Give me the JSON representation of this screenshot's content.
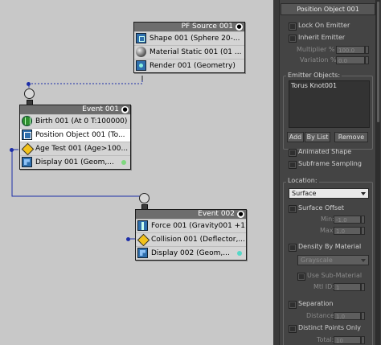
{
  "nodes": {
    "pf_source": {
      "title": "PF Source 001",
      "rows": [
        {
          "label": "Shape 001 (Sphere 20-...",
          "icon": "shape-icon"
        },
        {
          "label": "Material Static 001 (01 ...",
          "icon": "material-icon"
        },
        {
          "label": "Render 001 (Geometry)",
          "icon": "render-icon"
        }
      ]
    },
    "event1": {
      "title": "Event 001",
      "rows": [
        {
          "label": "Birth 001 (At 0 T:100000)",
          "icon": "birth-icon"
        },
        {
          "label": "Position Object 001 (To...",
          "icon": "position-icon"
        },
        {
          "label": "Age Test 001 (Age>100...",
          "icon": "test-icon"
        },
        {
          "label": "Display 001 (Geom,...",
          "icon": "display-icon",
          "dot_color": "#7fd87f"
        }
      ]
    },
    "event2": {
      "title": "Event 002",
      "rows": [
        {
          "label": "Force 001 (Gravity001 +1)",
          "icon": "force-icon"
        },
        {
          "label": "Collision 001 (Deflector,...",
          "icon": "test-icon"
        },
        {
          "label": "Display 002 (Geom,...",
          "icon": "display-icon",
          "dot_color": "#55d8c8"
        }
      ]
    }
  },
  "panel": {
    "title": "Position Object 001",
    "lock_on_emitter": "Lock On Emitter",
    "inherit_emitter": "Inherit Emitter",
    "multiplier_label": "Multiplier %",
    "multiplier_value": "100.0",
    "variation_label": "Variation %",
    "variation_value": "0.0",
    "emitter_objects_label": "Emitter Objects:",
    "emitter_objects": [
      "Torus Knot001"
    ],
    "add_label": "Add",
    "by_list_label": "By List",
    "remove_label": "Remove",
    "animated_shape": "Animated Shape",
    "subframe_sampling": "Subframe Sampling",
    "location_label": "Location:",
    "location_value": "Surface",
    "surface_offset": "Surface Offset",
    "min_label": "Min:",
    "min_value": "-1.0",
    "max_label": "Max:",
    "max_value": "1.0",
    "density_by_material": "Density By Material",
    "density_dropdown": "Grayscale",
    "use_sub_material": "Use Sub-Material",
    "mtl_id_label": "Mtl ID:",
    "mtl_id_value": "1",
    "separation": "Separation",
    "distance_label": "Distance:",
    "distance_value": "1.0",
    "distinct_points_only": "Distinct Points Only",
    "total_label": "Total:",
    "total_value": "10"
  },
  "colors": {
    "link_blue": "#1d2ea8",
    "title_bar": "#6d6d6d",
    "selected_row": "#ffffff",
    "dropdown_active": "#e8e8e8"
  }
}
